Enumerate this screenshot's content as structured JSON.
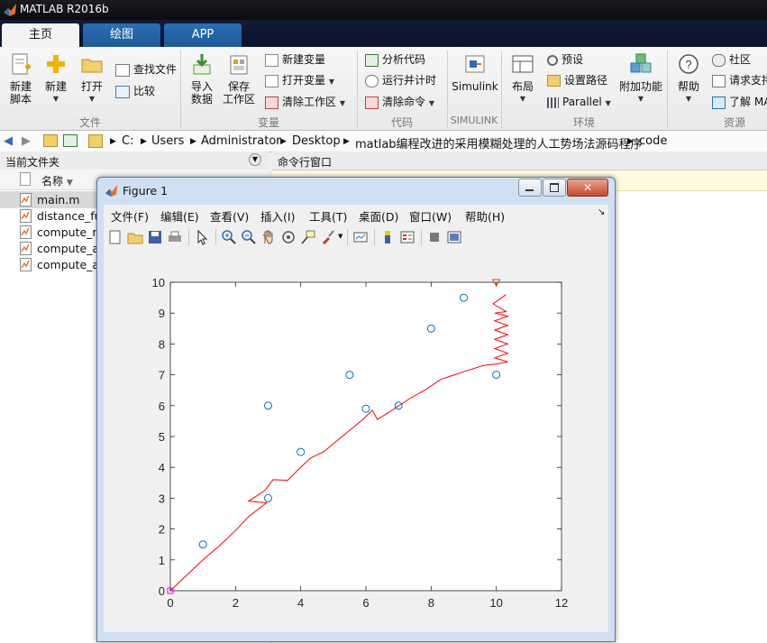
{
  "app": {
    "title": "MATLAB R2016b"
  },
  "tabs": [
    {
      "label": "主页",
      "active": true
    },
    {
      "label": "绘图",
      "active": false
    },
    {
      "label": "APP",
      "active": false
    }
  ],
  "ribbon": {
    "new_script_l1": "新建",
    "new_script_l2": "脚本",
    "new_label": "新建",
    "open_label": "打开",
    "find_files": "查找文件",
    "compare": "比较",
    "import_l1": "导入",
    "import_l2": "数据",
    "save_ws_l1": "保存",
    "save_ws_l2": "工作区",
    "new_variable": "新建变量",
    "open_variable": "打开变量",
    "clear_workspace": "清除工作区",
    "analyze_code": "分析代码",
    "run_and_time": "运行并计时",
    "clear_commands": "清除命令",
    "simulink": "Simulink",
    "layout": "布局",
    "preferences": "预设",
    "set_path": "设置路径",
    "parallel": "Parallel",
    "addons": "附加功能",
    "help": "帮助",
    "community": "社区",
    "request_support": "请求支持",
    "learn_matlab": "了解 MA",
    "groups": {
      "file": "文件",
      "variable": "变量",
      "code": "代码",
      "simulink": "SIMULINK",
      "environment": "环境",
      "resources": "资源"
    }
  },
  "address": {
    "crumbs": [
      "C:",
      "Users",
      "Administrator",
      "Desktop",
      "matlab编程改进的采用模糊处理的人工势场法源码程序",
      "code"
    ]
  },
  "current_folder": {
    "title": "当前文件夹",
    "name_col": "名称",
    "files": [
      "main.m",
      "distance_fu",
      "compute_re",
      "compute_at",
      "compute_an"
    ]
  },
  "command_window": {
    "title": "命令行窗口"
  },
  "figure": {
    "title": "Figure 1",
    "menu": [
      "文件(F)",
      "编辑(E)",
      "查看(V)",
      "插入(I)",
      "工具(T)",
      "桌面(D)",
      "窗口(W)",
      "帮助(H)"
    ]
  },
  "chart_data": {
    "type": "scatter",
    "xlim": [
      0,
      12
    ],
    "ylim": [
      0,
      10
    ],
    "xticks": [
      0,
      2,
      4,
      6,
      8,
      10,
      12
    ],
    "yticks": [
      0,
      1,
      2,
      3,
      4,
      5,
      6,
      7,
      8,
      9,
      10
    ],
    "grid": false,
    "series": [
      {
        "kind": "markers",
        "marker": "circle",
        "color": "#0072bd",
        "points": [
          [
            1,
            1.5
          ],
          [
            3,
            3
          ],
          [
            3,
            6
          ],
          [
            4,
            4.5
          ],
          [
            5.5,
            7
          ],
          [
            6,
            5.9
          ],
          [
            7,
            6
          ],
          [
            8,
            8.5
          ],
          [
            9,
            9.5
          ],
          [
            10,
            7
          ]
        ]
      },
      {
        "kind": "line",
        "color": "#ff0000",
        "points": [
          [
            0,
            0
          ],
          [
            0.5,
            0.5
          ],
          [
            1,
            1
          ],
          [
            1.5,
            1.45
          ],
          [
            2,
            1.95
          ],
          [
            2.4,
            2.4
          ],
          [
            2.95,
            2.85
          ],
          [
            2.4,
            2.9
          ],
          [
            2.9,
            3.25
          ],
          [
            3.15,
            3.6
          ],
          [
            3.6,
            3.58
          ],
          [
            3.95,
            3.95
          ],
          [
            4.3,
            4.3
          ],
          [
            4.7,
            4.5
          ],
          [
            5.1,
            4.85
          ],
          [
            5.5,
            5.2
          ],
          [
            5.9,
            5.55
          ],
          [
            6.2,
            5.85
          ],
          [
            6.35,
            5.55
          ],
          [
            6.8,
            5.85
          ],
          [
            7.3,
            6.2
          ],
          [
            7.8,
            6.5
          ],
          [
            8.3,
            6.85
          ],
          [
            9,
            7.1
          ],
          [
            9.6,
            7.3
          ],
          [
            10,
            7.35
          ],
          [
            10.35,
            7.42
          ],
          [
            9.95,
            7.55
          ],
          [
            10.35,
            7.7
          ],
          [
            9.95,
            7.85
          ],
          [
            10.35,
            8.0
          ],
          [
            9.95,
            8.15
          ],
          [
            10.35,
            8.3
          ],
          [
            9.95,
            8.45
          ],
          [
            10.35,
            8.6
          ],
          [
            9.95,
            8.75
          ],
          [
            10.35,
            8.9
          ],
          [
            9.95,
            9.0
          ],
          [
            9.95,
            9.0
          ],
          [
            10.3,
            9.05
          ],
          [
            9.9,
            9.3
          ],
          [
            10.3,
            9.6
          ]
        ]
      },
      {
        "kind": "start",
        "marker": "square",
        "color": "#ff00ff",
        "points": [
          [
            0,
            0
          ]
        ]
      },
      {
        "kind": "goal",
        "marker": "triangle-down",
        "color": "#d95319",
        "points": [
          [
            10,
            10
          ]
        ]
      }
    ]
  }
}
